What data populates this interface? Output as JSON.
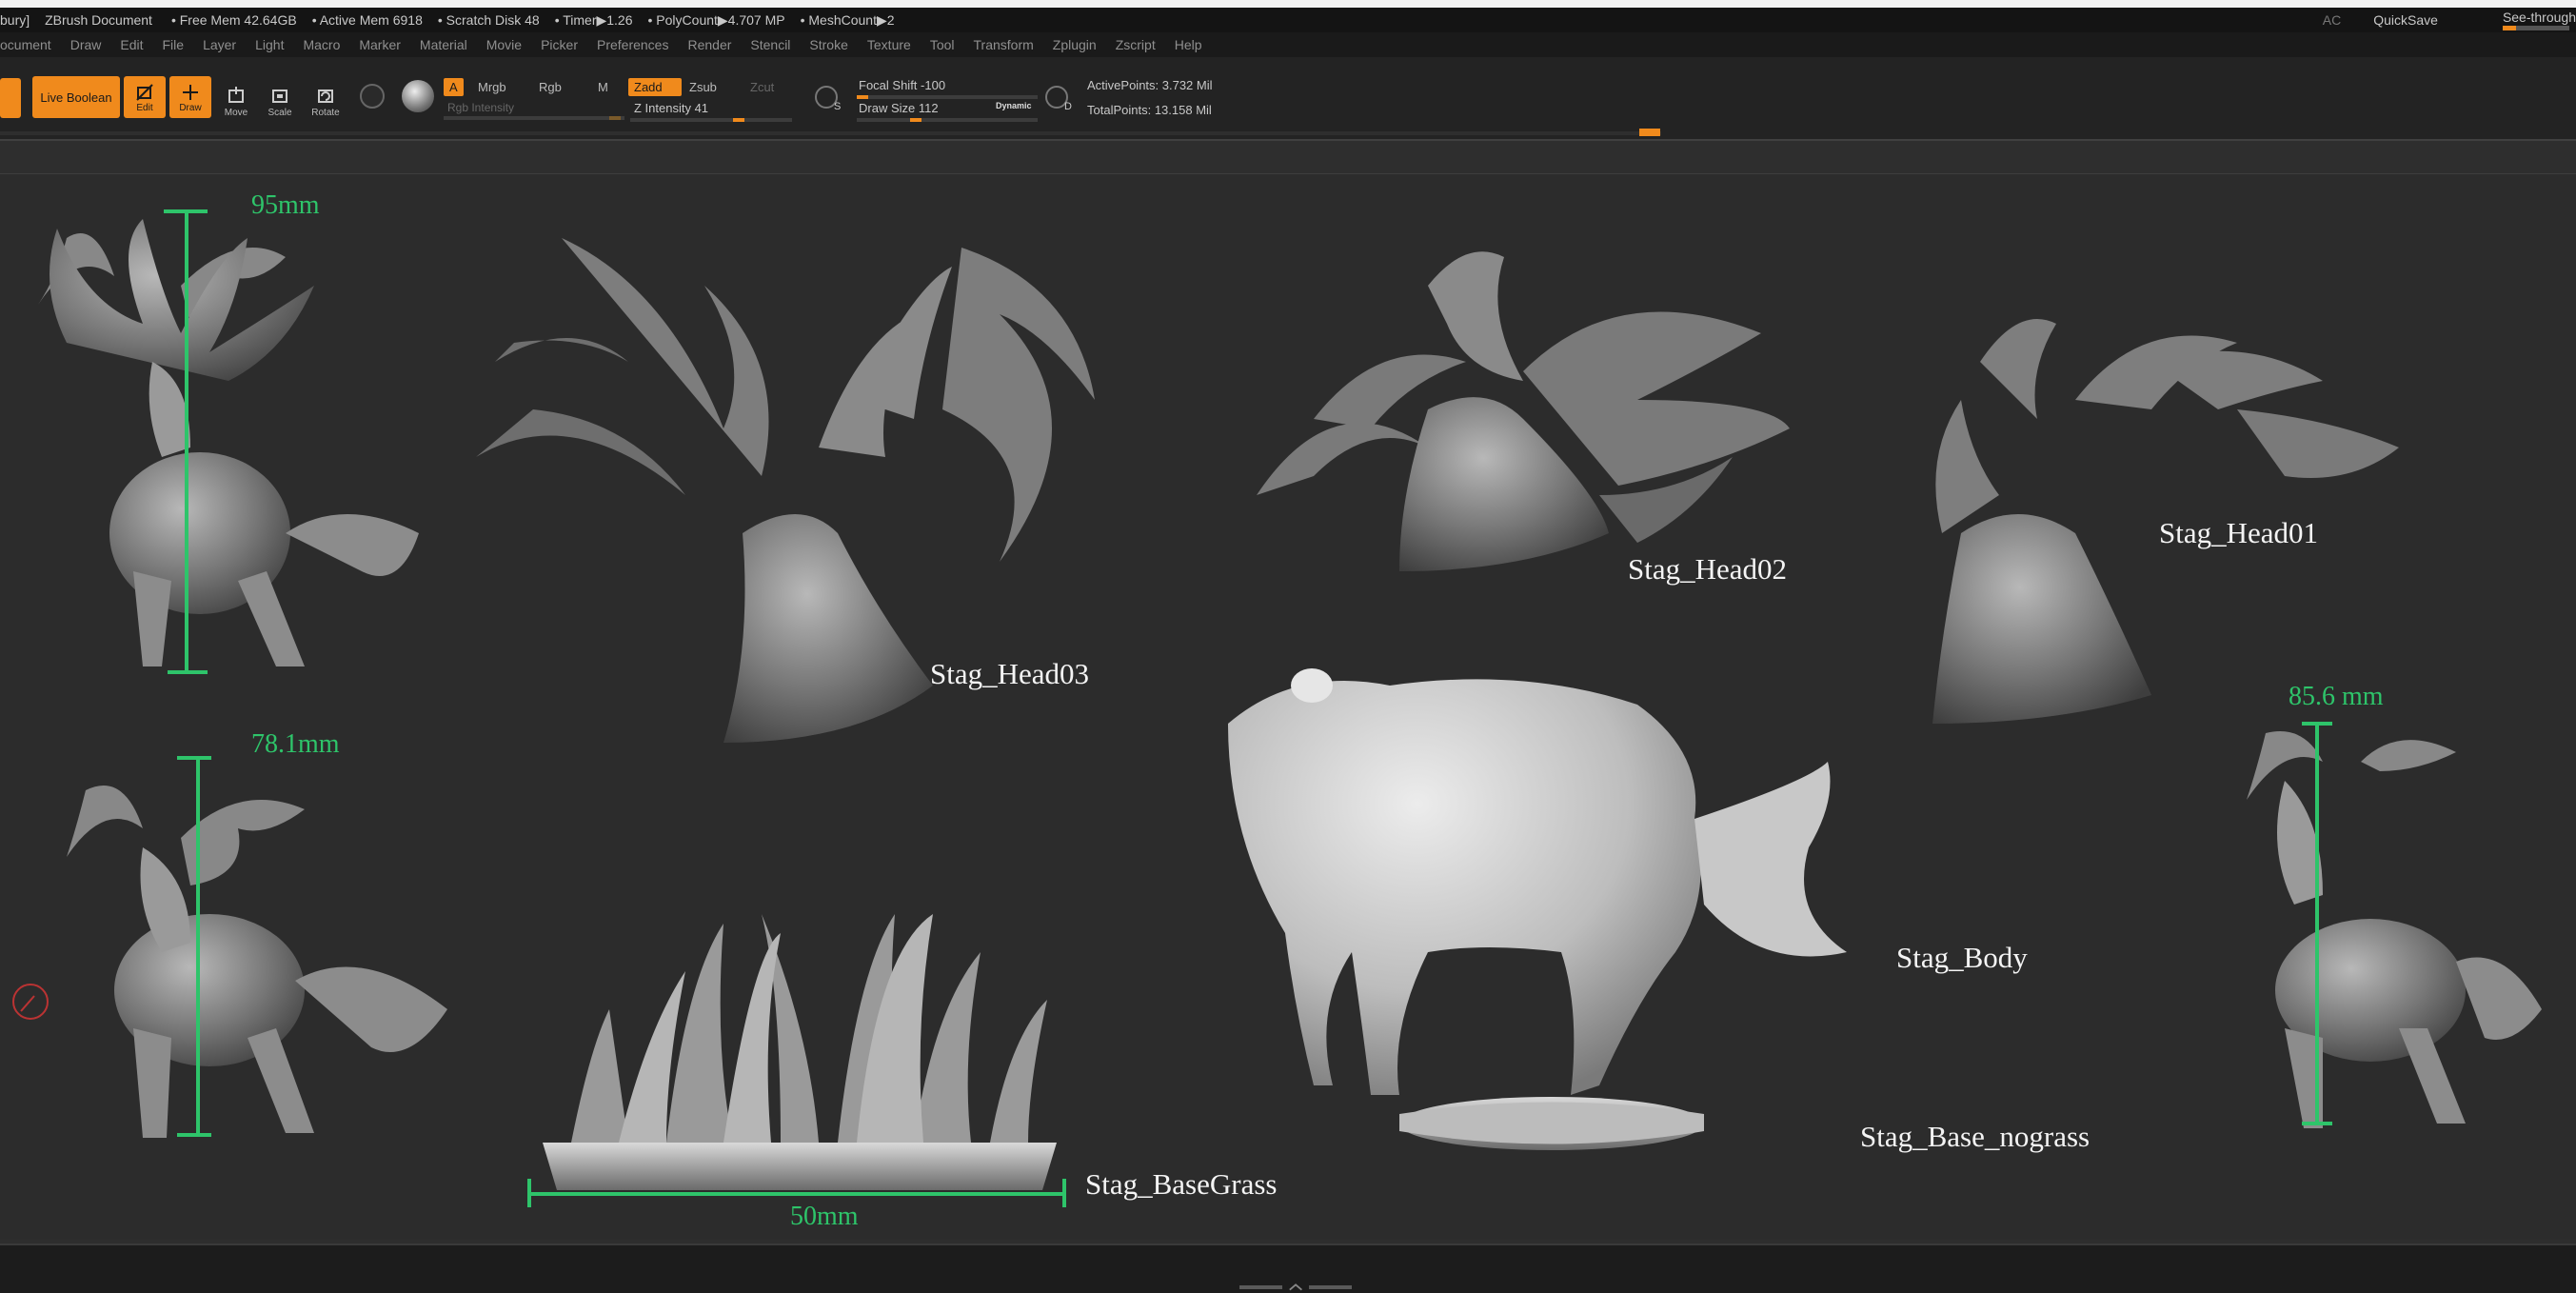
{
  "titlebar": {
    "doc": "bury]",
    "app": "ZBrush Document",
    "free_mem": "• Free Mem 42.64GB",
    "active_mem": "• Active Mem 6918",
    "scratch": "• Scratch Disk 48",
    "timer": "• Timer▶1.26",
    "polycount": "• PolyCount▶4.707 MP",
    "meshcount": "• MeshCount▶2",
    "ac": "AC",
    "quicksave": "QuickSave",
    "see_through": "See-through"
  },
  "menus": [
    "ocument",
    "Draw",
    "Edit",
    "File",
    "Layer",
    "Light",
    "Macro",
    "Marker",
    "Material",
    "Movie",
    "Picker",
    "Preferences",
    "Render",
    "Stencil",
    "Stroke",
    "Texture",
    "Tool",
    "Transform",
    "Zplugin",
    "Zscript",
    "Help"
  ],
  "toolbar": {
    "live_boolean": "Live Boolean",
    "edit": "Edit",
    "draw": "Draw",
    "move": "Move",
    "scale": "Scale",
    "rotate": "Rotate",
    "a": "A",
    "mrgb": "Mrgb",
    "rgb": "Rgb",
    "m": "M",
    "rgb_intensity": "Rgb Intensity",
    "zadd": "Zadd",
    "zsub": "Zsub",
    "zcut": "Zcut",
    "z_intensity": "Z Intensity 41",
    "focal_shift": "Focal Shift -100",
    "draw_size": "Draw Size 112",
    "dynamic": "Dynamic",
    "s": "S",
    "d": "D",
    "active_points": "ActivePoints: 3.732 Mil",
    "total_points": "TotalPoints: 13.158 Mil"
  },
  "labels": {
    "head03": "Stag_Head03",
    "head02": "Stag_Head02",
    "head01": "Stag_Head01",
    "body": "Stag_Body",
    "base_nograss": "Stag_Base_nograss",
    "basegrass": "Stag_BaseGrass"
  },
  "measurements": {
    "m1": "95mm",
    "m2": "78.1mm",
    "m3": "85.6 mm",
    "m4": "50mm"
  },
  "colors": {
    "accent": "#f08a1c",
    "measure": "#2ec46a",
    "viewport": "#2c2c2c"
  }
}
